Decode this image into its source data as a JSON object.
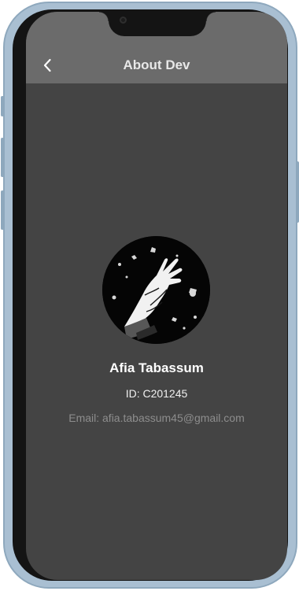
{
  "app_bar": {
    "title": "About Dev",
    "back_icon": "chevron-left-icon"
  },
  "profile": {
    "avatar_icon": "hand-illustration-avatar",
    "name": "Afia Tabassum",
    "id_text": "ID: C201245",
    "email_text": "Email: afia.tabassum45@gmail.com"
  },
  "colors": {
    "app_bar": "#6b6b6b",
    "background": "#444444",
    "name_text": "#ffffff",
    "email_text": "#8d8d8d",
    "device_frame": "#a9bfd2"
  }
}
